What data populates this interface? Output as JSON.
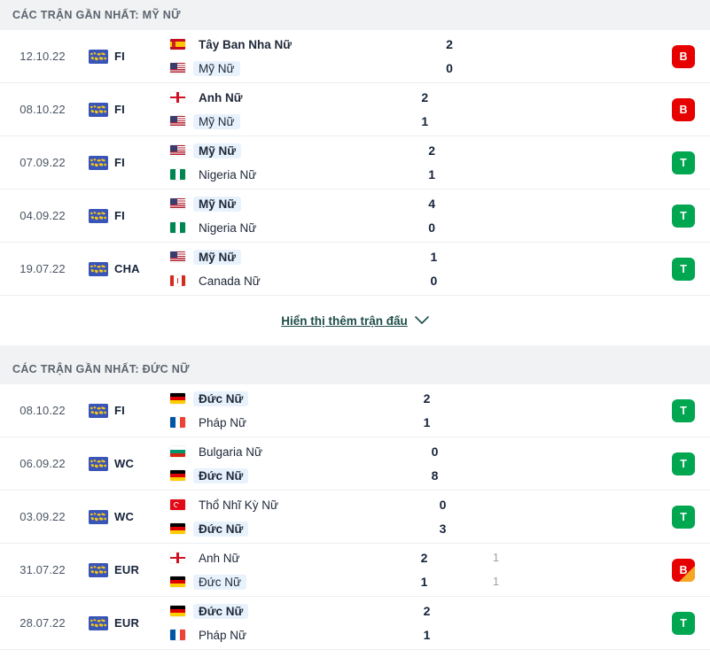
{
  "sections": [
    {
      "title": "CÁC TRẬN GẦN NHẤT: MỸ NỮ",
      "focus_team": "Mỹ Nữ",
      "matches": [
        {
          "date": "12.10.22",
          "competition": "FI",
          "comp_icon": "world-globe-icon",
          "home": {
            "team": "Tây Ban Nha Nữ",
            "flag": "spain",
            "score": "2",
            "pens": "",
            "bold": true,
            "highlight": false
          },
          "away": {
            "team": "Mỹ Nữ",
            "flag": "usa",
            "score": "0",
            "pens": "",
            "bold": false,
            "highlight": true
          },
          "result": {
            "letter": "B",
            "type": "loss"
          }
        },
        {
          "date": "08.10.22",
          "competition": "FI",
          "comp_icon": "world-globe-icon",
          "home": {
            "team": "Anh Nữ",
            "flag": "england",
            "score": "2",
            "pens": "",
            "bold": true,
            "highlight": false
          },
          "away": {
            "team": "Mỹ Nữ",
            "flag": "usa",
            "score": "1",
            "pens": "",
            "bold": false,
            "highlight": true
          },
          "result": {
            "letter": "B",
            "type": "loss"
          }
        },
        {
          "date": "07.09.22",
          "competition": "FI",
          "comp_icon": "world-globe-icon",
          "home": {
            "team": "Mỹ Nữ",
            "flag": "usa",
            "score": "2",
            "pens": "",
            "bold": true,
            "highlight": true
          },
          "away": {
            "team": "Nigeria Nữ",
            "flag": "nigeria",
            "score": "1",
            "pens": "",
            "bold": false,
            "highlight": false
          },
          "result": {
            "letter": "T",
            "type": "win"
          }
        },
        {
          "date": "04.09.22",
          "competition": "FI",
          "comp_icon": "world-globe-icon",
          "home": {
            "team": "Mỹ Nữ",
            "flag": "usa",
            "score": "4",
            "pens": "",
            "bold": true,
            "highlight": true
          },
          "away": {
            "team": "Nigeria Nữ",
            "flag": "nigeria",
            "score": "0",
            "pens": "",
            "bold": false,
            "highlight": false
          },
          "result": {
            "letter": "T",
            "type": "win"
          }
        },
        {
          "date": "19.07.22",
          "competition": "CHA",
          "comp_icon": "world-globe-icon",
          "home": {
            "team": "Mỹ Nữ",
            "flag": "usa",
            "score": "1",
            "pens": "",
            "bold": true,
            "highlight": true
          },
          "away": {
            "team": "Canada Nữ",
            "flag": "canada",
            "score": "0",
            "pens": "",
            "bold": false,
            "highlight": false
          },
          "result": {
            "letter": "T",
            "type": "win"
          }
        }
      ],
      "show_more": {
        "label": "Hiển thị thêm trận đấu",
        "icon": "chevron-down-icon"
      }
    },
    {
      "title": "CÁC TRẬN GẦN NHẤT: ĐỨC NỮ",
      "focus_team": "Đức Nữ",
      "matches": [
        {
          "date": "08.10.22",
          "competition": "FI",
          "comp_icon": "world-globe-icon",
          "home": {
            "team": "Đức Nữ",
            "flag": "germany",
            "score": "2",
            "pens": "",
            "bold": true,
            "highlight": true
          },
          "away": {
            "team": "Pháp Nữ",
            "flag": "france",
            "score": "1",
            "pens": "",
            "bold": false,
            "highlight": false
          },
          "result": {
            "letter": "T",
            "type": "win"
          }
        },
        {
          "date": "06.09.22",
          "competition": "WC",
          "comp_icon": "world-globe-icon",
          "home": {
            "team": "Bulgaria Nữ",
            "flag": "bulgaria",
            "score": "0",
            "pens": "",
            "bold": false,
            "highlight": false
          },
          "away": {
            "team": "Đức Nữ",
            "flag": "germany",
            "score": "8",
            "pens": "",
            "bold": true,
            "highlight": true
          },
          "result": {
            "letter": "T",
            "type": "win"
          }
        },
        {
          "date": "03.09.22",
          "competition": "WC",
          "comp_icon": "world-globe-icon",
          "home": {
            "team": "Thổ Nhĩ Kỳ Nữ",
            "flag": "turkey",
            "score": "0",
            "pens": "",
            "bold": false,
            "highlight": false
          },
          "away": {
            "team": "Đức Nữ",
            "flag": "germany",
            "score": "3",
            "pens": "",
            "bold": true,
            "highlight": true
          },
          "result": {
            "letter": "T",
            "type": "win"
          }
        },
        {
          "date": "31.07.22",
          "competition": "EUR",
          "comp_icon": "world-globe-icon",
          "home": {
            "team": "Anh Nữ",
            "flag": "england",
            "score": "2",
            "pens": "1",
            "bold": false,
            "highlight": false
          },
          "away": {
            "team": "Đức Nữ",
            "flag": "germany",
            "score": "1",
            "pens": "1",
            "bold": false,
            "highlight": true
          },
          "result": {
            "letter": "B",
            "type": "draw-pen"
          }
        },
        {
          "date": "28.07.22",
          "competition": "EUR",
          "comp_icon": "world-globe-icon",
          "home": {
            "team": "Đức Nữ",
            "flag": "germany",
            "score": "2",
            "pens": "",
            "bold": true,
            "highlight": true
          },
          "away": {
            "team": "Pháp Nữ",
            "flag": "france",
            "score": "1",
            "pens": "",
            "bold": false,
            "highlight": false
          },
          "result": {
            "letter": "T",
            "type": "win"
          }
        }
      ],
      "show_more": null
    }
  ],
  "colors": {
    "win": "#00a650",
    "loss": "#e60000",
    "pen_accent": "#f5a623",
    "highlight": "#e8f2fd",
    "header_bg": "#f1f2f3",
    "link": "#1e4d4a"
  }
}
